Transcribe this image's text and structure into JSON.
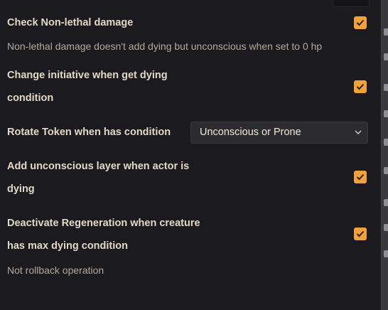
{
  "settings": [
    {
      "label": "Check Non-lethal damage",
      "hint": "Non-lethal damage doesn't add dying but unconscious when set to 0 hp",
      "checked": true
    },
    {
      "label_line1": "Change initiative when get dying",
      "label_line2": "condition",
      "checked": true
    },
    {
      "label": "Rotate Token when has condition",
      "select_value": "Unconscious or Prone"
    },
    {
      "label_line1": "Add unconscious layer when actor is",
      "label_line2": "dying",
      "checked": true
    },
    {
      "label_line1": "Deactivate Regeneration when creature",
      "label_line2": "has max dying condition",
      "hint": "Not rollback operation",
      "checked": true
    }
  ],
  "icons": {
    "checkbox": "checkmark-icon",
    "select_arrow": "chevron-down-icon"
  },
  "colors": {
    "accent": "#f2a23a",
    "background": "#1b1a1e",
    "label": "#e2d8c8",
    "hint": "#b5aa9a"
  }
}
